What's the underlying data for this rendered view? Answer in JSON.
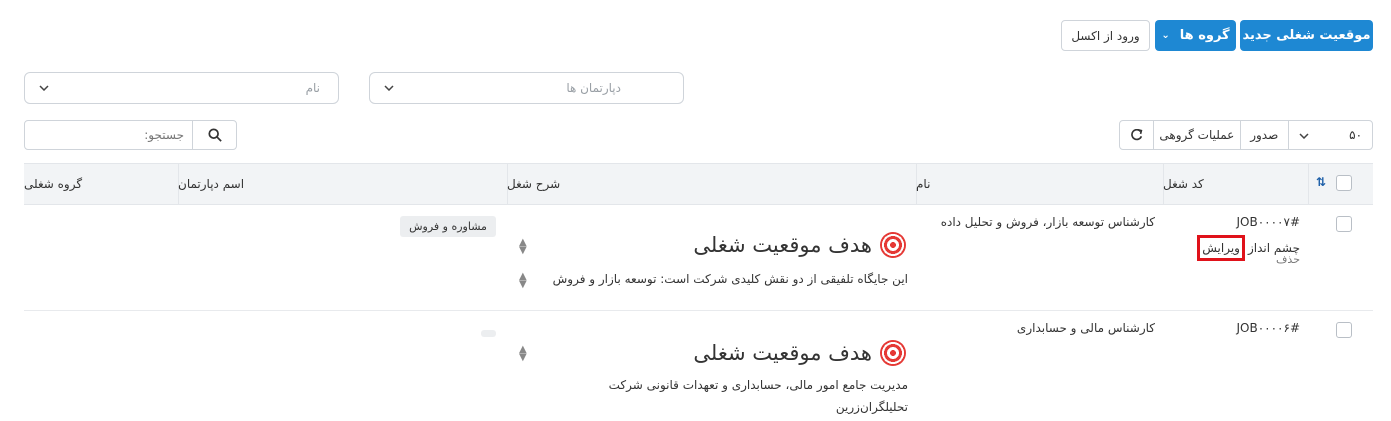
{
  "actions": {
    "new_position": "موقعیت شغلی جدید",
    "groups": "گروه ها",
    "import_excel": "ورود از اکسل"
  },
  "filters": {
    "department_placeholder": "دپارتمان ها",
    "name_placeholder": "نام"
  },
  "toolbar": {
    "page_size": "۵۰",
    "export": "صدور",
    "bulk_actions": "عملیات گروهی",
    "search_placeholder": "جستجو:"
  },
  "table": {
    "headers": {
      "code": "کد شغل",
      "name": "نام",
      "description": "شرح شغل",
      "department": "اسم دپارتمان",
      "group": "گروه شغلی"
    },
    "rows": [
      {
        "code": "#JOB۰۰۰۰۷",
        "actions": {
          "view": "چشم انداز",
          "edit": "ویرایش",
          "delete": "حذف"
        },
        "name": "کارشناس توسعه بازار، فروش و تحلیل داده",
        "description_title": "هدف موقعیت شغلی",
        "description_text": "این جایگاه تلفیقی از دو نقش کلیدی شرکت است: توسعه بازار و فروش",
        "department": "مشاوره و فروش",
        "group": ""
      },
      {
        "code": "#JOB۰۰۰۰۶",
        "name": "کارشناس مالی و حسابداری",
        "description_title": "هدف موقعیت شغلی",
        "description_text_line1": "مدیریت جامع امور مالی، حسابداری و تعهدات قانونی شرکت",
        "description_text_line2": "تحلیلگران‌زرین",
        "department": "",
        "group": ""
      }
    ]
  },
  "colors": {
    "primary": "#1e88d3",
    "highlight_border": "#e0121a"
  }
}
